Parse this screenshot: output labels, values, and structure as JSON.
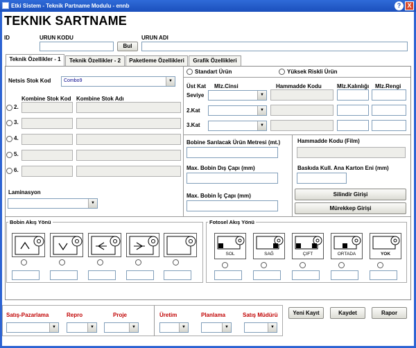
{
  "window": {
    "title": "Etki Sistem - Teknik Partname Modulu - ennb",
    "help": "?",
    "close": "X"
  },
  "page_title": "TEKNIK SARTNAME",
  "header": {
    "id_label": "ID",
    "urun_kodu_label": "URUN KODU",
    "urun_adi_label": "URUN ADI",
    "bul_button": "Bul"
  },
  "tabs": [
    {
      "label": "Teknik Özellikler - 1",
      "active": true
    },
    {
      "label": "Teknik Özellikler - 2",
      "active": false
    },
    {
      "label": "Paketleme Özellikleri",
      "active": false
    },
    {
      "label": "Grafik Özellikleri",
      "active": false
    }
  ],
  "left": {
    "netsis_label": "Netsis Stok Kod",
    "netsis_value": "Combo9",
    "kombine_kod_label": "Kombine Stok Kod",
    "kombine_adi_label": "Kombine Stok Adı",
    "rows": [
      "2.",
      "3.",
      "4.",
      "5.",
      "6."
    ],
    "laminasyon_label": "Laminasyon"
  },
  "right": {
    "standart_urun": "Standart Ürün",
    "yuksek_riskli": "Yüksek Riskli Ürün",
    "ust_kat": "Üst Kat",
    "seviye": "Seviye",
    "mlz_cinsi": "Mlz.Cinsi",
    "hammadde_kodu": "Hammadde Kodu",
    "mlz_kalinligi": "Mlz.Kalınlığı",
    "mlz_rengi": "Mlz.Rengi",
    "kat2": "2.Kat",
    "kat3": "3.Kat",
    "bobine_label": "Bobine Sarılacak Ürün Metresi (mt.)",
    "hammadde_film_label": "Hammadde Kodu (Film)",
    "max_dis_label": "Max. Bobin Dış Çapı (mm)",
    "baskida_label": "Baskıda Kull. Ana Karton Eni (mm)",
    "max_ic_label": "Max. Bobin İç Çapı (mm)",
    "silindir_button": "Silindir Girişi",
    "murekkep_button": "Mürekkep Girişi"
  },
  "bobin": {
    "title": "Bobin Akış Yönü",
    "items": [
      "up",
      "down",
      "left",
      "right",
      "blank"
    ]
  },
  "fotosel": {
    "title": "Fotosel Akış Yönü",
    "items": [
      "SOL",
      "SAĞ",
      "ÇIFT",
      "ORTADA",
      "YOK"
    ]
  },
  "footer": {
    "satis_pazarlama": "Satış-Pazarlama",
    "repro": "Repro",
    "proje": "Proje",
    "uretim": "Üretim",
    "planlama": "Planlama",
    "satis_muduru": "Satış Müdürü",
    "yeni_kayit": "Yeni Kayıt",
    "kaydet": "Kaydet",
    "rapor": "Rapor"
  },
  "colors": {
    "titlebar": "#1b4fbc",
    "frame": "#2c63d3",
    "footer_label": "#c00000"
  }
}
